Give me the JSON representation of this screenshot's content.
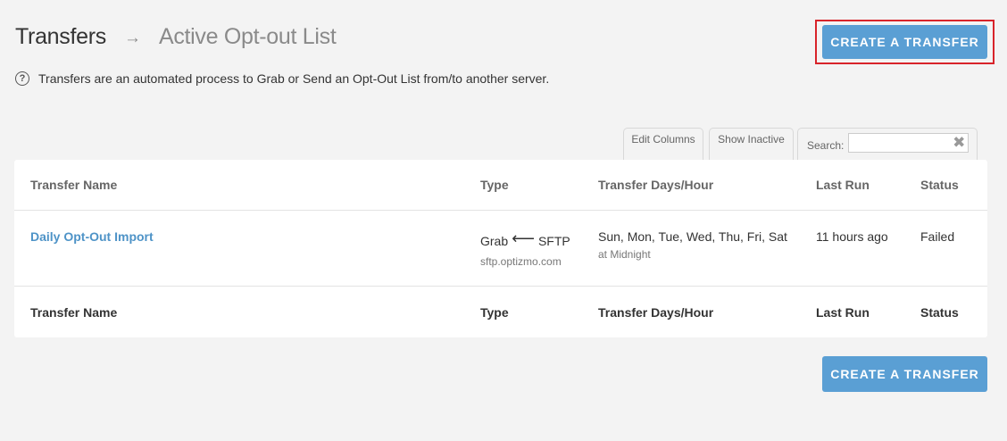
{
  "header": {
    "breadcrumb_root": "Transfers",
    "breadcrumb_current": "Active Opt-out List",
    "help_text": "Transfers are an automated process to Grab or Send an Opt-Out List from/to another server.",
    "create_button_label": "CREATE A TRANSFER"
  },
  "toolbar": {
    "edit_columns_label": "Edit Columns",
    "show_inactive_label": "Show Inactive",
    "search_label": "Search:",
    "search_value": ""
  },
  "table": {
    "columns": [
      "Transfer Name",
      "Type",
      "Transfer Days/Hour",
      "Last Run",
      "Status"
    ],
    "rows": [
      {
        "name": "Daily Opt-Out Import",
        "type_action": "Grab",
        "type_protocol": "SFTP",
        "type_host": "sftp.optizmo.com",
        "days": "Sun, Mon, Tue, Wed, Thu, Fri, Sat",
        "hour": "at Midnight",
        "last_run": "11 hours ago",
        "status": "Failed"
      }
    ]
  },
  "footer": {
    "create_button_label": "CREATE A TRANSFER"
  },
  "colors": {
    "accent": "#5a9fd4",
    "link": "#4e93c7",
    "highlight_outline": "#d8232a",
    "background": "#f3f3f3"
  },
  "icons": {
    "breadcrumb_separator": "arrow-right-icon",
    "help": "question-circle-icon",
    "type_direction": "arrow-left-icon",
    "search_clear": "close-icon"
  }
}
